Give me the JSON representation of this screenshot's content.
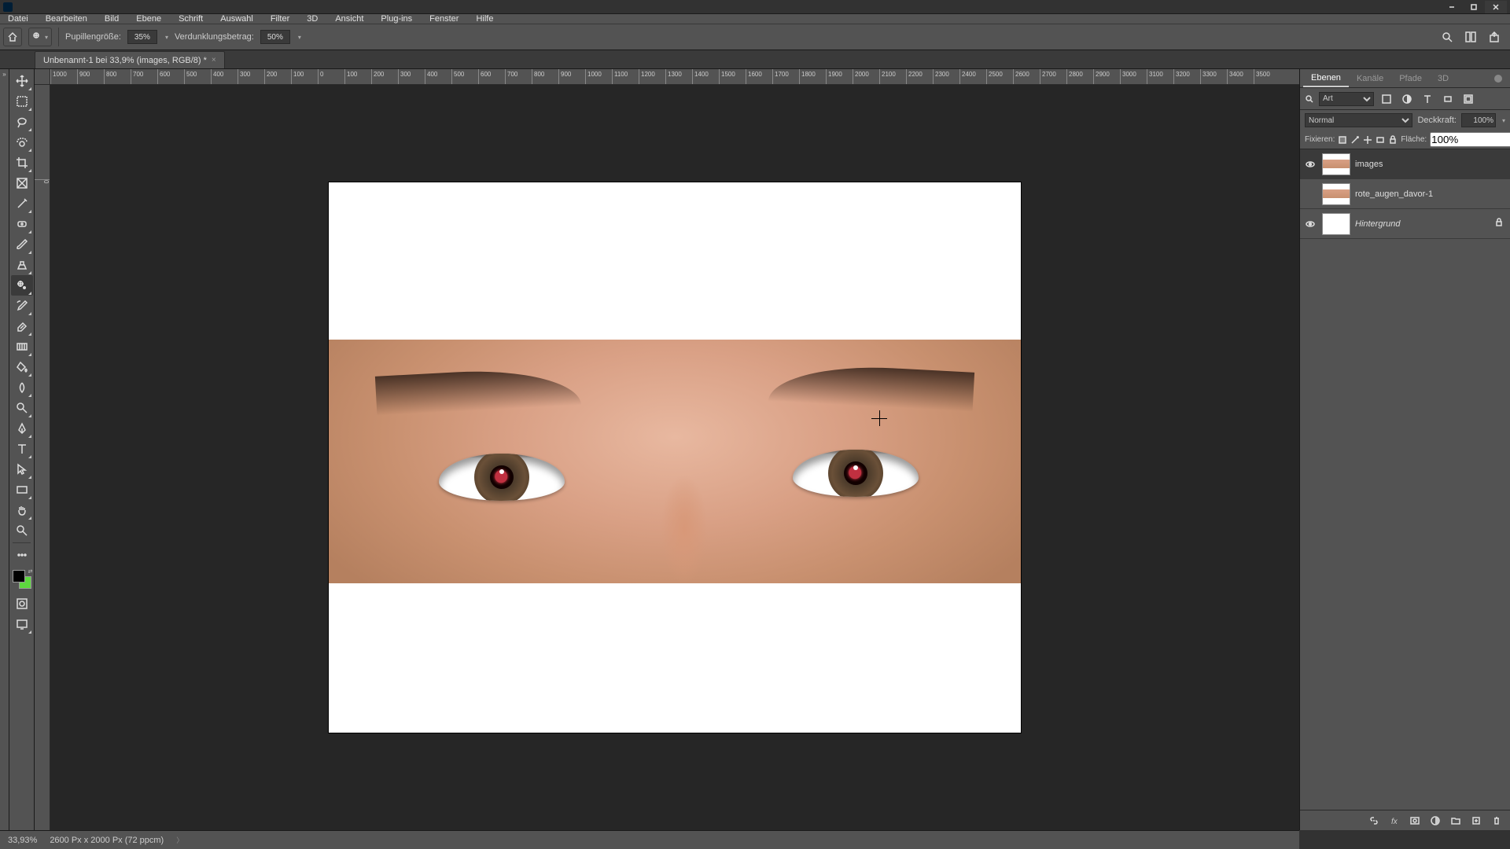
{
  "app": {
    "name": "Ps"
  },
  "menu": {
    "items": [
      "Datei",
      "Bearbeiten",
      "Bild",
      "Ebene",
      "Schrift",
      "Auswahl",
      "Filter",
      "3D",
      "Ansicht",
      "Plug-ins",
      "Fenster",
      "Hilfe"
    ]
  },
  "options": {
    "pupil_label": "Pupillengröße:",
    "pupil_value": "35%",
    "darken_label": "Verdunklungsbetrag:",
    "darken_value": "50%"
  },
  "document": {
    "tab_title": "Unbenannt-1 bei 33,9% (images, RGB/8) *"
  },
  "ruler_h": [
    "1000",
    "900",
    "800",
    "700",
    "600",
    "500",
    "400",
    "300",
    "200",
    "100",
    "0",
    "100",
    "200",
    "300",
    "400",
    "500",
    "600",
    "700",
    "800",
    "900",
    "1000",
    "1100",
    "1200",
    "1300",
    "1400",
    "1500",
    "1600",
    "1700",
    "1800",
    "1900",
    "2000",
    "2100",
    "2200",
    "2300",
    "2400",
    "2500",
    "2600",
    "2700",
    "2800",
    "2900",
    "3000",
    "3100",
    "3200",
    "3300",
    "3400",
    "3500"
  ],
  "ruler_v": [
    "0"
  ],
  "panels": {
    "tabs": [
      "Ebenen",
      "Kanäle",
      "Pfade",
      "3D"
    ],
    "search_label": "Art",
    "blend_mode": "Normal",
    "opacity_label": "Deckkraft:",
    "opacity_value": "100%",
    "lock_label": "Fixieren:",
    "fill_label": "Fläche:",
    "fill_value": "100%",
    "layers": [
      {
        "name": "images",
        "visible": true,
        "selected": true,
        "thumb": "face",
        "locked": false
      },
      {
        "name": "rote_augen_davor-1",
        "visible": false,
        "selected": false,
        "thumb": "face",
        "locked": false
      },
      {
        "name": "Hintergrund",
        "visible": true,
        "selected": false,
        "thumb": "white",
        "locked": true,
        "italic": true
      }
    ]
  },
  "status": {
    "zoom": "33,93%",
    "doc_info": "2600 Px x 2000 Px (72 ppcm)"
  },
  "colors": {
    "fg": "#000000",
    "bg": "#5dd83e"
  }
}
